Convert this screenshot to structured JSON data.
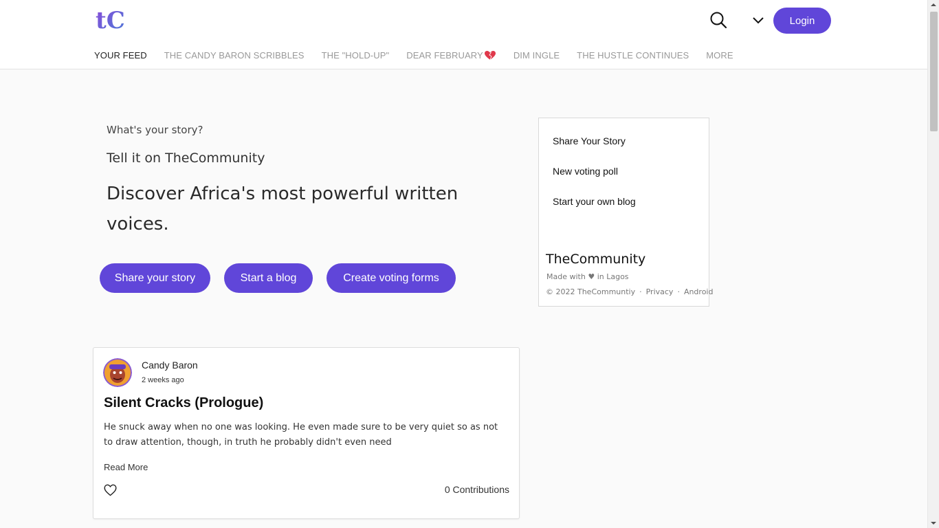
{
  "brand": {
    "logo_text": "tC",
    "colors": {
      "accent": "#6046d9",
      "logo_blue": "#4a7bd8",
      "logo_purple": "#8a4ad8"
    }
  },
  "header": {
    "login_label": "Login",
    "icons": {
      "search": "search-icon",
      "menu": "chevron-down-icon"
    }
  },
  "nav": {
    "items": [
      {
        "label": "YOUR FEED",
        "active": true
      },
      {
        "label": "THE CANDY BARON SCRIBBLES",
        "active": false
      },
      {
        "label": "THE \"HOLD-UP\"",
        "active": false
      },
      {
        "label": "DEAR FEBRUARY",
        "active": false,
        "icon": "heart-icon"
      },
      {
        "label": "DIM INGLE",
        "active": false
      },
      {
        "label": "THE HUSTLE CONTINUES",
        "active": false
      },
      {
        "label": "MORE",
        "active": false
      }
    ]
  },
  "hero": {
    "question": "What's your story?",
    "subtitle": "Tell it on TheCommunity",
    "title": "Discover Africa's most powerful written voices.",
    "buttons": [
      "Share your story",
      "Start a blog",
      "Create voting forms"
    ]
  },
  "sidebar": {
    "links": [
      "Share Your Story",
      "New voting poll",
      "Start your own blog"
    ],
    "brand_name": "TheCommunity",
    "made_with_prefix": "Made with",
    "made_with_heart": "♥",
    "made_with_suffix": "in Lagos",
    "footer": {
      "copyright": "© 2022 TheCommuntiy",
      "privacy": "Privacy",
      "android": "Android",
      "separator": "·"
    }
  },
  "post": {
    "author": "Candy Baron",
    "time": "2 weeks ago",
    "title": "Silent Cracks (Prologue)",
    "excerpt": "He snuck away when no one was looking. He even made sure to be very quiet so as not to draw attention, though, in truth he probably didn't even need",
    "read_more": "Read More",
    "contributions": "0 Contributions",
    "like_icon": "heart-outline-icon"
  }
}
